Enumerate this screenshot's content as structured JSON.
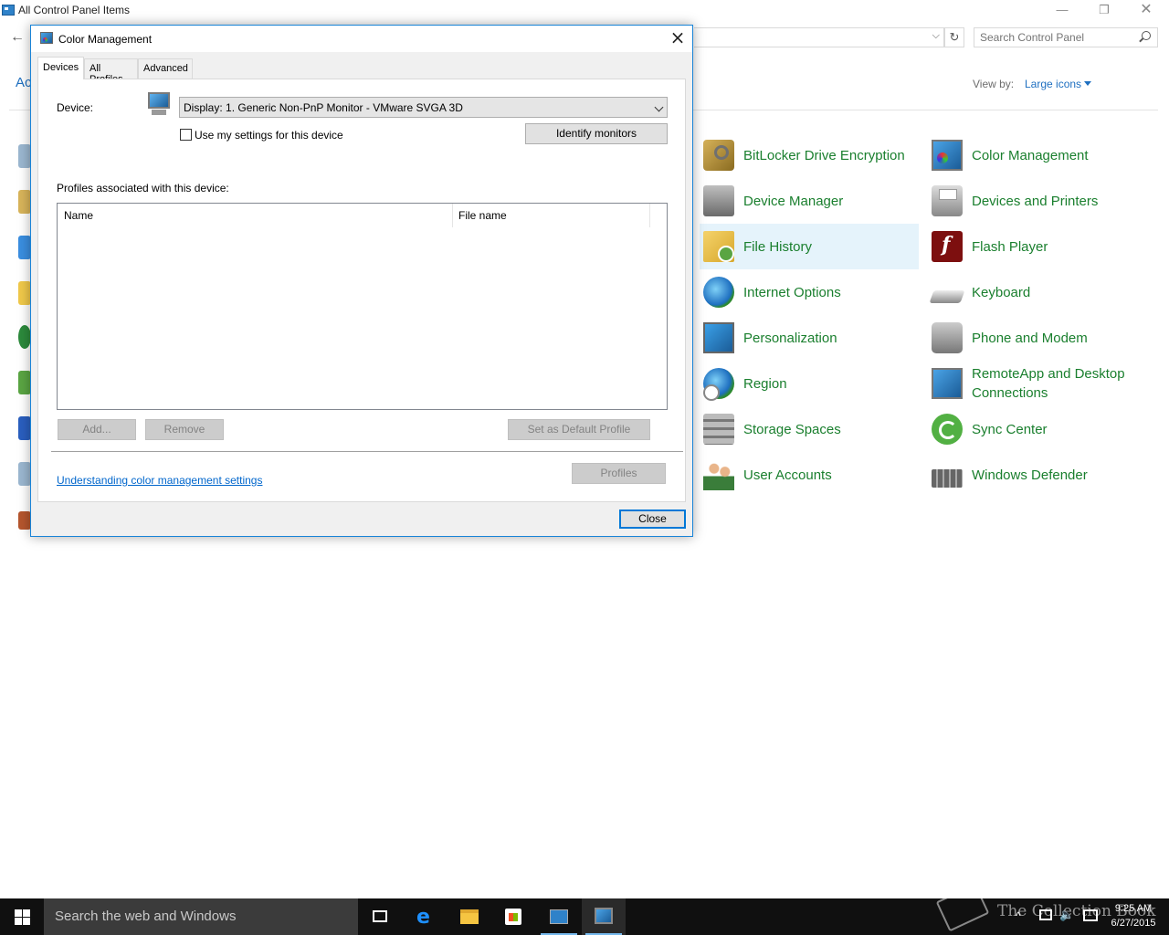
{
  "control_panel": {
    "title": "All Control Panel Items",
    "window_buttons": {
      "minimize": "—",
      "restore": "❐",
      "close": "✕"
    },
    "back": "←",
    "address_dropdown": "⌵",
    "refresh": "↻",
    "search_placeholder": "Search Control Panel",
    "adjust_heading_partial": "Ac",
    "view_by_label": "View by:",
    "view_by_value": "Large icons",
    "items": [
      {
        "label": "BitLocker Drive Encryption",
        "icon": "bitlocker-icon"
      },
      {
        "label": "Color Management",
        "icon": "color-management-icon"
      },
      {
        "label": "Device Manager",
        "icon": "device-manager-icon"
      },
      {
        "label": "Devices and Printers",
        "icon": "devices-printers-icon"
      },
      {
        "label": "File History",
        "icon": "file-history-icon",
        "highlighted": true
      },
      {
        "label": "Flash Player",
        "icon": "flash-player-icon"
      },
      {
        "label": "Internet Options",
        "icon": "internet-options-icon"
      },
      {
        "label": "Keyboard",
        "icon": "keyboard-icon"
      },
      {
        "label": "Personalization",
        "icon": "personalization-icon"
      },
      {
        "label": "Phone and Modem",
        "icon": "phone-modem-icon"
      },
      {
        "label": "Region",
        "icon": "region-icon"
      },
      {
        "label": "RemoteApp and Desktop Connections",
        "icon": "remoteapp-icon"
      },
      {
        "label": "Storage Spaces",
        "icon": "storage-spaces-icon"
      },
      {
        "label": "Sync Center",
        "icon": "sync-center-icon"
      },
      {
        "label": "User Accounts",
        "icon": "user-accounts-icon"
      },
      {
        "label": "Windows Defender",
        "icon": "windows-defender-icon"
      }
    ]
  },
  "dialog": {
    "title": "Color Management",
    "close_glyph": "×",
    "tabs": [
      "Devices",
      "All Profiles",
      "Advanced"
    ],
    "active_tab": "Devices",
    "device_label": "Device:",
    "device_value": "Display: 1. Generic Non-PnP Monitor - VMware SVGA 3D",
    "use_my_settings_label": "Use my settings for this device",
    "use_my_settings_checked": false,
    "identify_button": "Identify monitors",
    "profiles_label": "Profiles associated with this device:",
    "columns": [
      "Name",
      "File name"
    ],
    "rows": [],
    "add_button": "Add...",
    "remove_button": "Remove",
    "set_default_button": "Set as Default Profile",
    "link": "Understanding color management settings",
    "profiles_button": "Profiles",
    "close_button": "Close"
  },
  "taskbar": {
    "search_placeholder": "Search the web and Windows",
    "time": "9:25 AM",
    "date": "6/27/2015",
    "tray_up": "^",
    "tray_volume": "🔈",
    "watermark": "The Collection Book"
  },
  "colors": {
    "link_green": "#1a7f2e",
    "accent_blue": "#0078d7",
    "highlight": "#e5f3fb",
    "taskbar": "#101010"
  }
}
